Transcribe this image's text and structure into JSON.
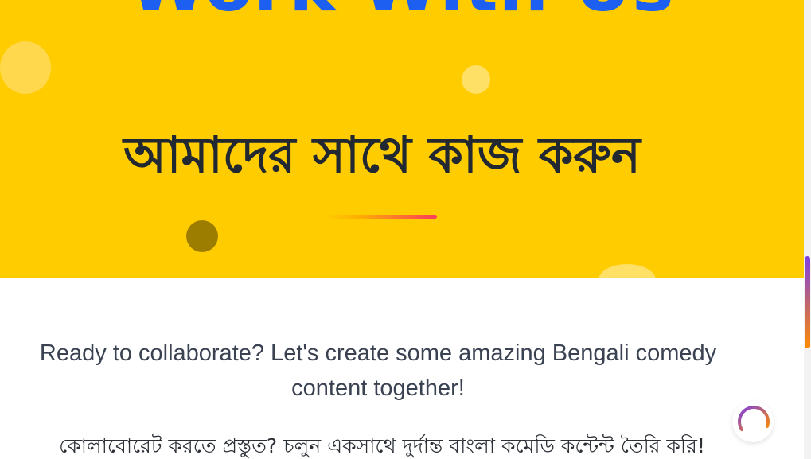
{
  "hero": {
    "title_en": "Work With Us",
    "title_bn": "আমাদের সাথে কাজ করুন"
  },
  "content": {
    "tagline_en": "Ready to collaborate? Let's create some amazing Bengali comedy content together!",
    "tagline_bn": "কোলাবোরেট করতে প্রস্তুত? চলুন একসাথে দুর্দান্ত বাংলা কমেডি কন্টেন্ট তৈরি করি!"
  },
  "icons": {
    "loader": "loading-spinner-icon"
  },
  "colors": {
    "hero_bg": "#ffcc00",
    "title_en": "#1d5ff0",
    "title_bn": "#222831",
    "tagline_en": "#3a4252",
    "tagline_bn": "#2b2f36",
    "underline_start": "#ffb000",
    "underline_end": "#ff3b5c",
    "dot_dark": "#9c7d00",
    "dot_light": "#ffd84d",
    "dot_pale": "#ffe066",
    "scroll_thumb_start": "#7b3fe4",
    "scroll_thumb_end": "#ff8a00"
  }
}
